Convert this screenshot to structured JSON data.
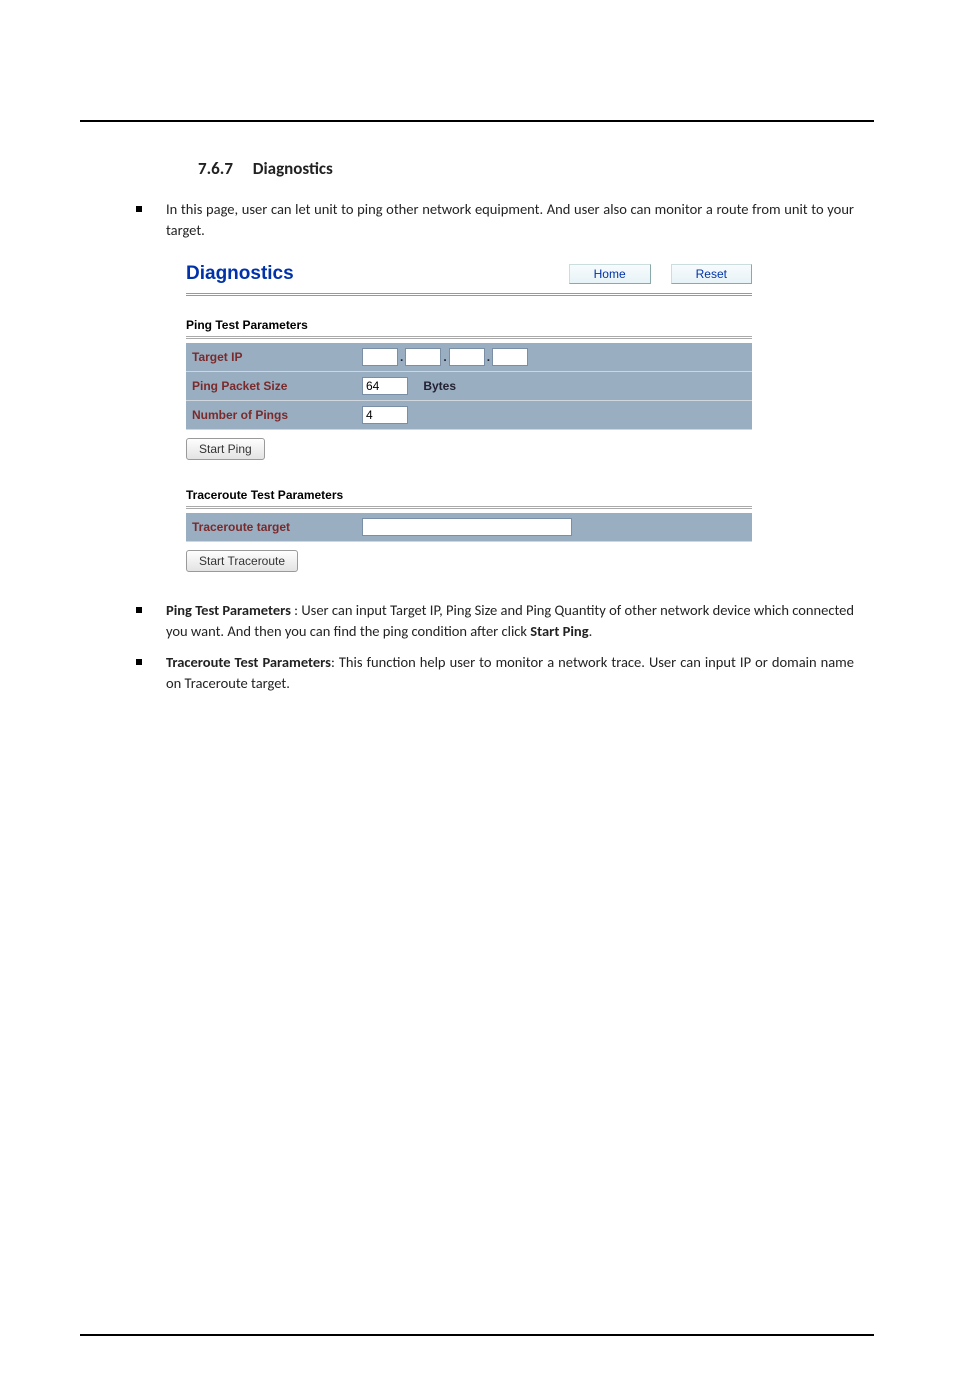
{
  "section": {
    "number": "7.6.7",
    "title": "Diagnostics"
  },
  "intro": "In this page, user can let unit to ping other network equipment. And user also can monitor a route from unit to your target.",
  "panel": {
    "title": "Diagnostics",
    "home": "Home",
    "reset": "Reset",
    "ping_section": "Ping Test Parameters",
    "target_ip_label": "Target IP",
    "target_ip": {
      "a": "",
      "b": "",
      "c": "",
      "d": ""
    },
    "packet_size_label": "Ping Packet Size",
    "packet_size_value": "64",
    "packet_size_unit": "Bytes",
    "num_pings_label": "Number of Pings",
    "num_pings_value": "4",
    "start_ping": "Start Ping",
    "tr_section": "Traceroute Test Parameters",
    "tr_target_label": "Traceroute target",
    "tr_target_value": "",
    "start_tr": "Start Traceroute"
  },
  "notes": {
    "n1_bold": "Ping Test Parameters",
    "n1_rest_a": " : User can input Target IP, Ping Size and Ping Quantity of other network device which connected you want. And then you can find the ping condition after click ",
    "n1_bold2": "Start Ping",
    "n1_end": ".",
    "n2_bold": "Traceroute Test Parameters",
    "n2_rest": ": This function help user to monitor a network trace. User can input IP or domain name on Traceroute target."
  }
}
